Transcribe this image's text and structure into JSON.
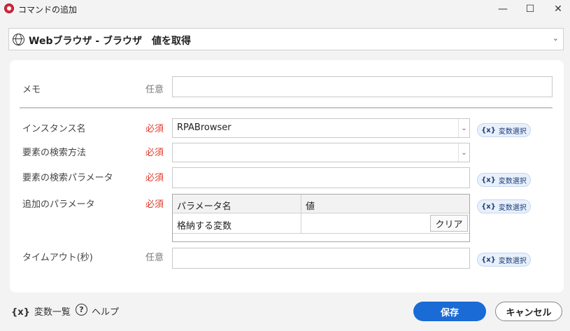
{
  "window": {
    "title": "コマンドの追加",
    "minimize": "—",
    "maximize": "☐",
    "close": "✕"
  },
  "command": {
    "label": "Webブラウザ - ブラウザ　値を取得",
    "icon": "globe-icon"
  },
  "form": {
    "memo": {
      "label": "メモ",
      "badge": "任意",
      "value": ""
    },
    "instance": {
      "label": "インスタンス名",
      "badge": "必須",
      "value": "RPABrowser"
    },
    "search_method": {
      "label": "要素の検索方法",
      "badge": "必須",
      "value": ""
    },
    "search_param": {
      "label": "要素の検索パラメータ",
      "badge": "必須",
      "value": ""
    },
    "extra_param": {
      "label": "追加のパラメータ",
      "badge": "必須",
      "columns": [
        "パラメータ名",
        "値"
      ],
      "rows": [
        {
          "name": "格納する変数",
          "value": "",
          "clear": "クリア"
        }
      ]
    },
    "timeout": {
      "label": "タイムアウト(秒)",
      "badge": "任意",
      "value": ""
    }
  },
  "var_button": {
    "icon": "{x}",
    "label": "変数選択"
  },
  "footer": {
    "var_list_icon": "{x}",
    "var_list": "変数一覧",
    "help_icon": "?",
    "help": "ヘルプ",
    "save": "保存",
    "cancel": "キャンセル"
  },
  "colors": {
    "primary": "#1a6bd6",
    "required": "#e0392b",
    "var_button_bg": "#e8f0fb"
  }
}
